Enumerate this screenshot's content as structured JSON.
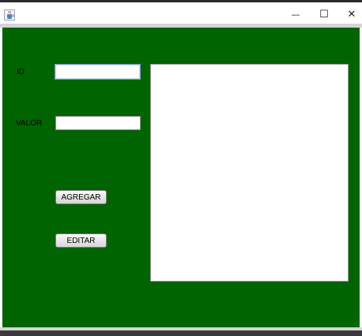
{
  "window": {
    "controls": {
      "minimize_glyph": "—",
      "maximize_glyph": "☐",
      "close_glyph": "✕"
    },
    "app_icon": "java-cup-icon"
  },
  "form": {
    "id_label": "ID",
    "id_value": "",
    "valor_label": "VALOR",
    "valor_value": ""
  },
  "buttons": {
    "agregar_label": "AGREGAR",
    "editar_label": "EDITAR"
  },
  "colors": {
    "panel_background": "#006400",
    "window_background": "#ffffff"
  }
}
